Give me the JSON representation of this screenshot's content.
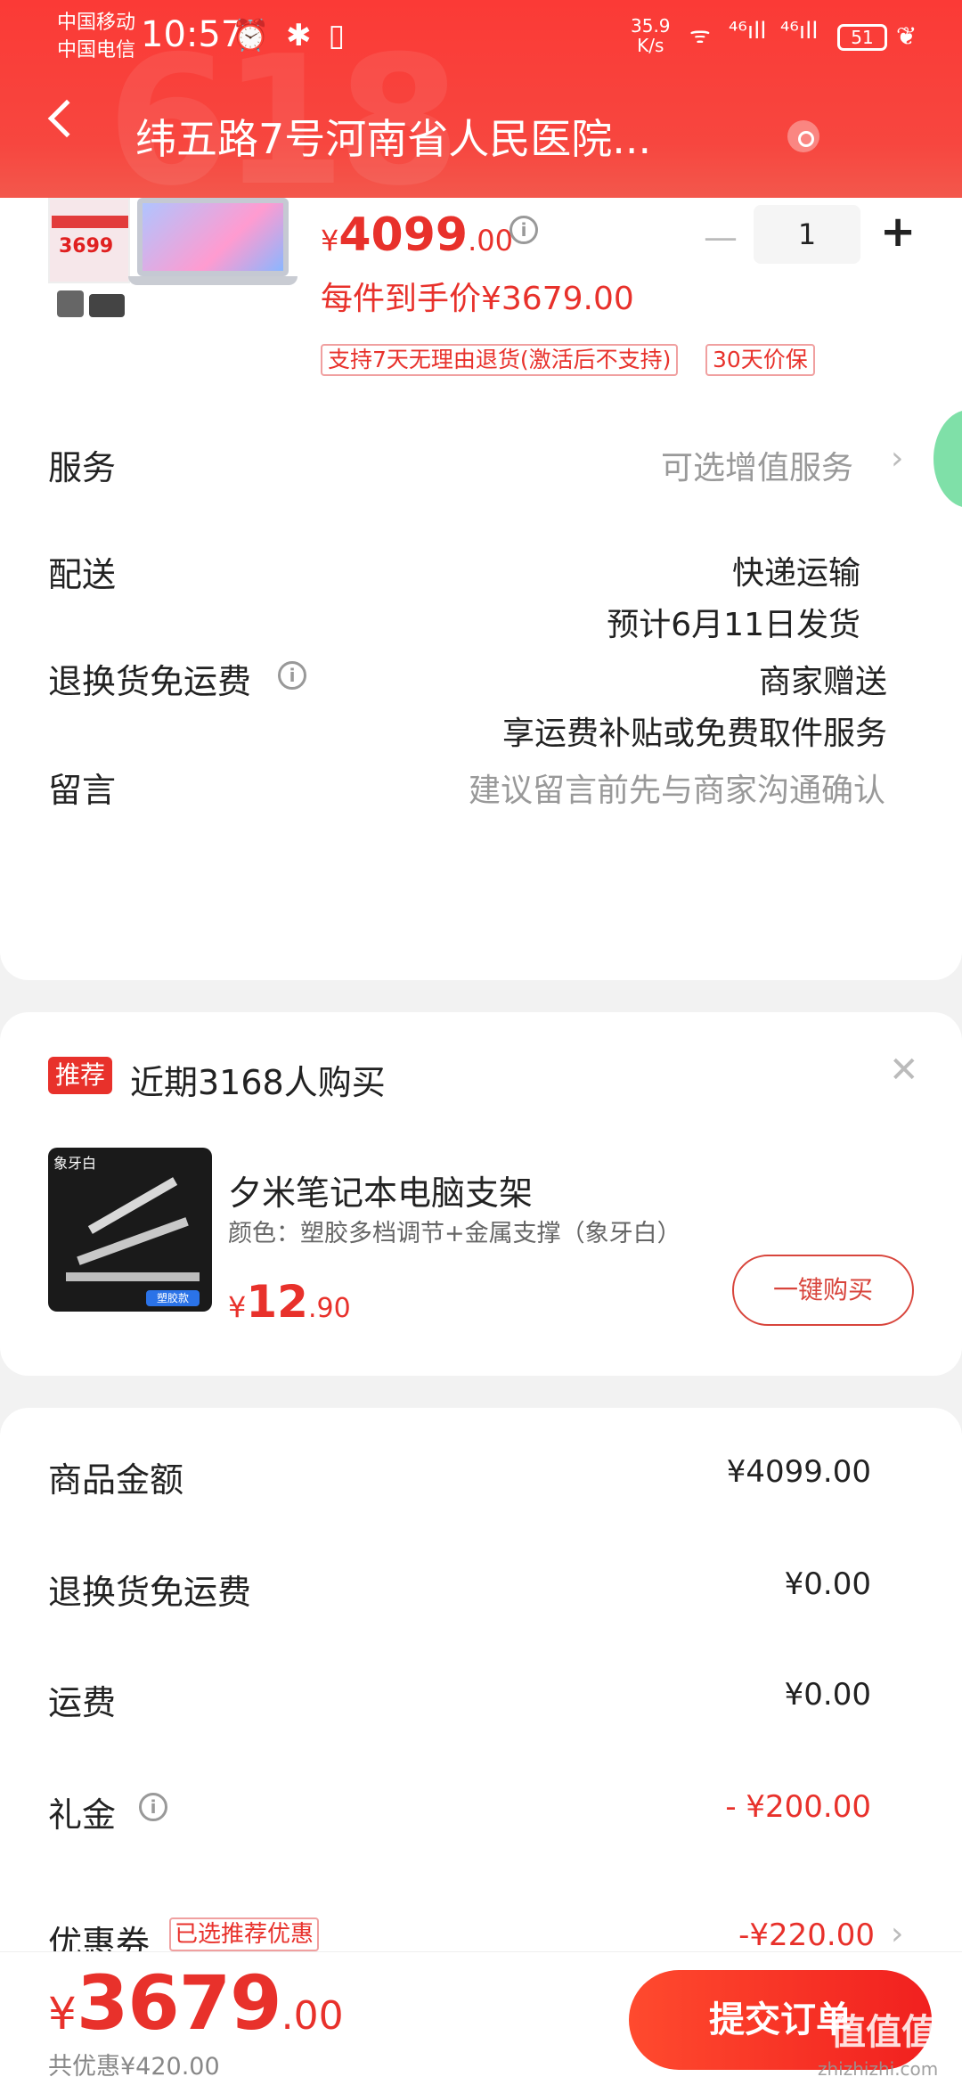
{
  "status_bar": {
    "carrier1": "中国移动",
    "carrier2": "中国电信",
    "time": "10:57",
    "icons": "⏰ ✱ ▯",
    "net_speed": "35.9",
    "net_unit": "K/s",
    "signal1": "⁴⁶ıll",
    "signal2": "⁴⁶ıll",
    "battery": "51"
  },
  "header": {
    "deco": "618",
    "address": "纬五路7号河南省人民医院..."
  },
  "product": {
    "thumb_price": "3699",
    "price_symbol": "¥",
    "price_int": "4099",
    "price_dec": ".00",
    "quantity": "1",
    "each_price": "每件到手价¥3679.00",
    "badge1": "支持7天无理由退货(激活后不支持)",
    "badge2": "30天价保"
  },
  "rows": {
    "service_label": "服务",
    "service_value": "可选增值服务",
    "delivery_label": "配送",
    "delivery_value1": "快递运输",
    "delivery_value2": "预计6月11日发货",
    "return_label": "退换货免运费",
    "return_value1": "商家赠送",
    "return_value2": "享运费补贴或免费取件服务",
    "message_label": "留言",
    "message_placeholder": "建议留言前先与商家沟通确认"
  },
  "recommend": {
    "tag": "推荐",
    "recent": "近期3168人购买",
    "img_label": "象牙白",
    "img_badge": "塑胶款",
    "title": "夕米笔记本电脑支架",
    "color": "颜色：塑胶多档调节+金属支撑（象牙白）",
    "price_symbol": "¥",
    "price_int": "12",
    "price_dec": ".90",
    "buy_button": "一键购买"
  },
  "summary": {
    "goods_label": "商品金额",
    "goods_value": "¥4099.00",
    "return_label": "退换货免运费",
    "return_value": "¥0.00",
    "shipping_label": "运费",
    "shipping_value": "¥0.00",
    "gift_label": "礼金",
    "gift_value": "- ¥200.00",
    "coupon_label": "优惠券",
    "coupon_tag": "已选推荐优惠",
    "coupon_value": "-¥220.00"
  },
  "bottom": {
    "total_symbol": "¥",
    "total_int": "3679",
    "total_dec": ".00",
    "saving": "共优惠¥420.00",
    "submit": "提交订单",
    "watermark": "值值值",
    "watermark_url": "zhizhizhi.com"
  },
  "colors": {
    "accent": "#e8312b",
    "header": "#fb3a36"
  }
}
